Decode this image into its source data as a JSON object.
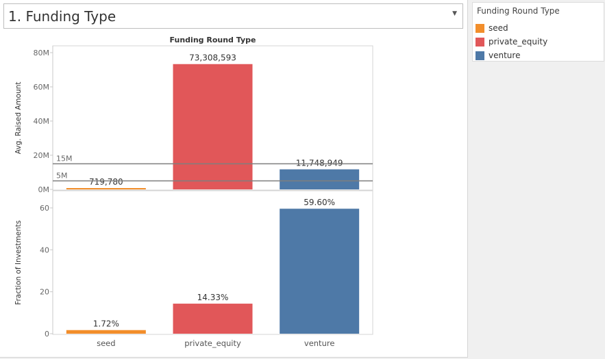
{
  "filter": {
    "title": "1. Funding Type"
  },
  "legend": {
    "title": "Funding Round Type",
    "items": [
      {
        "label": "seed",
        "color": "#F28E2B"
      },
      {
        "label": "private_equity",
        "color": "#E15759"
      },
      {
        "label": "venture",
        "color": "#4E79A7"
      }
    ]
  },
  "chart_data": {
    "type": "bar",
    "title": "Funding Round Type",
    "categories": [
      "seed",
      "private_equity",
      "venture"
    ],
    "colors": [
      "#F28E2B",
      "#E15759",
      "#4E79A7"
    ],
    "panes": [
      {
        "ylabel": "Avg. Raised Amount",
        "ylim": [
          0,
          80000000
        ],
        "ticks": [
          0,
          20000000,
          40000000,
          60000000,
          80000000
        ],
        "tick_labels": [
          "0M",
          "20M",
          "40M",
          "60M",
          "80M"
        ],
        "values": [
          719780,
          73308593,
          11748949
        ],
        "data_labels": [
          "719,780",
          "73,308,593",
          "11,748,949"
        ],
        "reference_lines": [
          {
            "value": 15000000,
            "label": "15M"
          },
          {
            "value": 5000000,
            "label": "5M"
          }
        ]
      },
      {
        "ylabel": "Fraction of Investments",
        "ylim": [
          0,
          66
        ],
        "ticks": [
          0,
          20,
          40,
          60
        ],
        "tick_labels": [
          "0",
          "20",
          "40",
          "60"
        ],
        "values": [
          1.72,
          14.33,
          59.6
        ],
        "data_labels": [
          "1.72%",
          "14.33%",
          "59.60%"
        ],
        "reference_lines": []
      }
    ],
    "grid": false,
    "legend_position": "top-right"
  }
}
